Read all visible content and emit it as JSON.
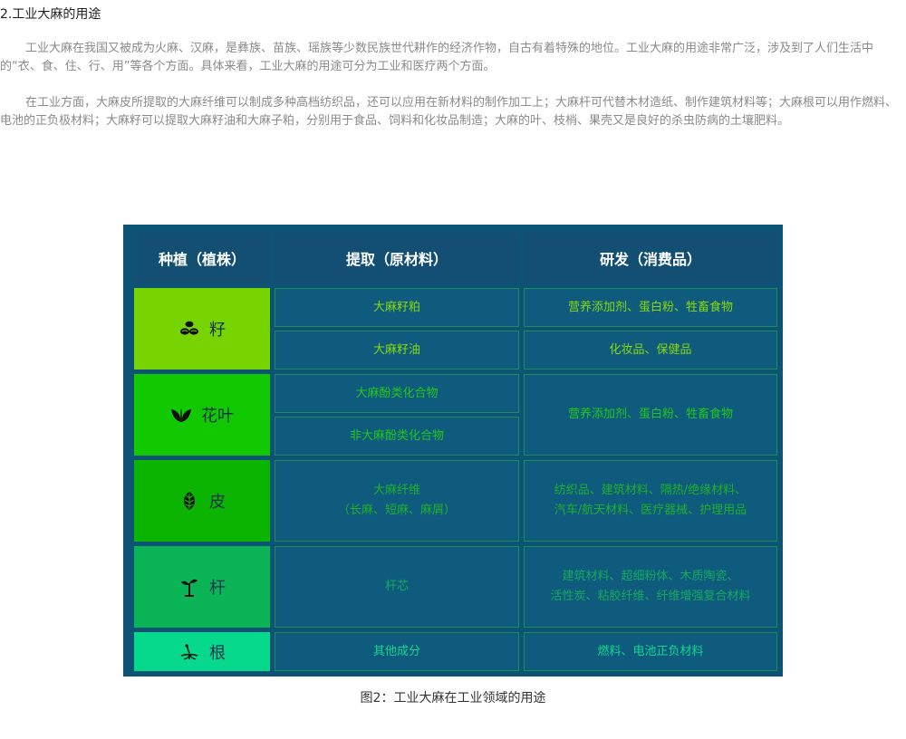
{
  "heading": "2.工业大麻的用途",
  "paragraphs": [
    "工业大麻在我国又被成为火麻、汉麻，是彝族、苗族、瑶族等少数民族世代耕作的经济作物，自古有着特殊的地位。工业大麻的用途非常广泛，涉及到了人们生活中的“衣、食、住、行、用”等各个方面。具体来看，工业大麻的用途可分为工业和医疗两个方面。",
    "在工业方面，大麻皮所提取的大麻纤维可以制成多种高档纺织品，还可以应用在新材料的制作加工上；大麻杆可代替木材造纸、制作建筑材料等；大麻根可以用作燃料、电池的正负极材料；大麻籽可以提取大麻籽油和大麻子粕，分别用于食品、饲料和化妆品制造；大麻的叶、枝梢、果壳又是良好的杀虫防病的土壤肥料。"
  ],
  "figure": {
    "headers": [
      "种植（植株）",
      "提取（原材料）",
      "研发（消费品）"
    ],
    "rows": [
      {
        "plant": "籽",
        "icon": "seeds-icon",
        "color": "#77d400"
      },
      {
        "plant": "花叶",
        "icon": "leaves-icon",
        "color": "#12c800"
      },
      {
        "plant": "皮",
        "icon": "leaf-icon",
        "color": "#0ab400"
      },
      {
        "plant": "杆",
        "icon": "sprout-icon",
        "color": "#0bb557"
      },
      {
        "plant": "根",
        "icon": "root-icon",
        "color": "#07d98c"
      }
    ],
    "extract": {
      "seed_meal": "大麻籽粕",
      "seed_oil": "大麻籽油",
      "cannabinoids": "大麻酚类化合物",
      "non_cannabinoids": "非大麻酚类化合物",
      "fiber": "大麻纤维",
      "fiber_types": "（长麻、短麻、麻屑）",
      "core": "杆芯",
      "other": "其他成分"
    },
    "products": {
      "seed_meal": "营养添加剂、蛋白粉、牲畜食物",
      "seed_oil": "化妆品、保健品",
      "leaves": "营养添加剂、蛋白粉、牲畜食物",
      "fiber_line1": "纺织品、建筑材料、隔热/绝缘材料、",
      "fiber_line2": "汽车/航天材料、医疗器械、护理用品",
      "core_line1": "建筑材料、超细粉体、木质陶瓷、",
      "core_line2": "活性炭、粘胶纤维、纤维增强复合材料",
      "root": "燃料、电池正负材料"
    },
    "text_colors": {
      "seed": "#8ad810",
      "leaf": "#22c61c",
      "skin": "#20b02a",
      "stem": "#16aa5e",
      "root": "#14d68c"
    },
    "caption": "图2：工业大麻在工业领域的用途"
  }
}
